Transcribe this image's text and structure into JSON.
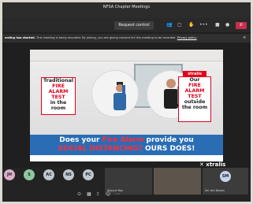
{
  "window": {
    "title": "NFSA Chapter Meetings"
  },
  "toolbar": {
    "request_control_label": "Request control",
    "icons": [
      "participants-icon",
      "chat-icon",
      "raise-hand-icon",
      "more-icon",
      "camera-icon",
      "mic-icon",
      "leave-icon"
    ]
  },
  "banner": {
    "bold": "ording has started.",
    "text": " This meeting is being recorded. By joining, you are giving consent for this meeting to be recorded.",
    "link": "Privacy policy",
    "close": "×"
  },
  "slide": {
    "left_card": {
      "line1": "Traditional",
      "line2": "FIRE",
      "line3": "ALARM",
      "line4": "TEST",
      "line5": "in the",
      "line6": "room"
    },
    "right_card": {
      "line1": "Our",
      "line2": "FIRE",
      "line3": "ALARM",
      "line4": "TEST",
      "line5": "outside",
      "line6": "the room"
    },
    "badge": "xtralis",
    "question": {
      "part1": "Does your ",
      "part2": "Fire Alarm",
      "part3": " provide you",
      "part4": "SOCIAL DISTANCING?",
      "part5": " OURS DOES!"
    }
  },
  "bottom_logo": "✕ xtralis",
  "participants": {
    "avatars": [
      {
        "initials": "JH",
        "color": "#d7b0c8"
      },
      {
        "initials": "S",
        "color": "#8fc8a0"
      },
      {
        "initials": "AC",
        "color": "#bfc7cf"
      },
      {
        "initials": "NS",
        "color": "#bfc7cf"
      },
      {
        "initials": "PC",
        "color": "#bfc7cf"
      },
      {
        "initials": "SM",
        "color": "#c7d1ec"
      }
    ],
    "tiles": [
      "Shayne Ray",
      "",
      "Jim Van Bowen"
    ]
  }
}
